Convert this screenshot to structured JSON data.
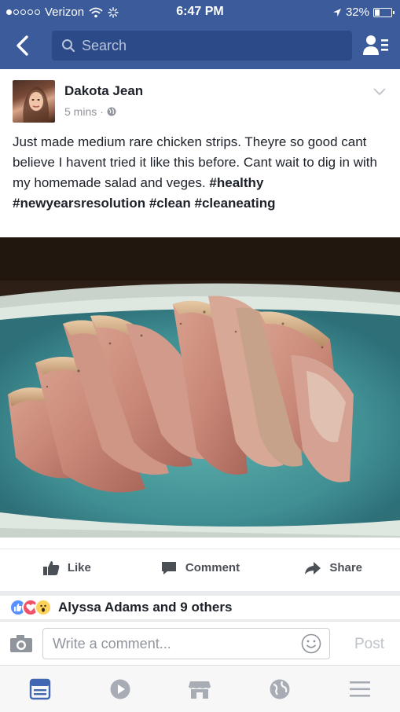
{
  "status_bar": {
    "carrier": "Verizon",
    "time": "6:47 PM",
    "battery_percent": "32%",
    "battery_level": 0.32
  },
  "nav": {
    "search_placeholder": "Search",
    "icons": [
      "back-icon",
      "search-icon",
      "friends-icon"
    ]
  },
  "post": {
    "author": "Dakota Jean",
    "time": "5 mins",
    "privacy_icon": "globe-icon",
    "text_body": "Just made medium rare chicken strips. Theyre so good cant believe I havent tried it like this before. Cant wait to dig in with my homemade salad and veges. ",
    "hashtags": "#healthy #newyearsresolution #clean #cleaneating",
    "actions": {
      "like": "Like",
      "comment": "Comment",
      "share": "Share"
    }
  },
  "reactions": {
    "text": "Alyssa Adams and 9 others",
    "types": [
      "like-reaction-icon",
      "love-reaction-icon",
      "wow-reaction-icon"
    ]
  },
  "comment_bar": {
    "placeholder": "Write a comment...",
    "post_label": "Post"
  },
  "tab_bar": {
    "items": [
      "news-feed-icon",
      "video-icon",
      "marketplace-icon",
      "notifications-globe-icon",
      "menu-icon"
    ]
  },
  "colors": {
    "brand_blue": "#3b5b9b",
    "search_bg": "#2c4a87",
    "tab_active": "#4267b2",
    "tab_inactive": "#a7acb5"
  }
}
